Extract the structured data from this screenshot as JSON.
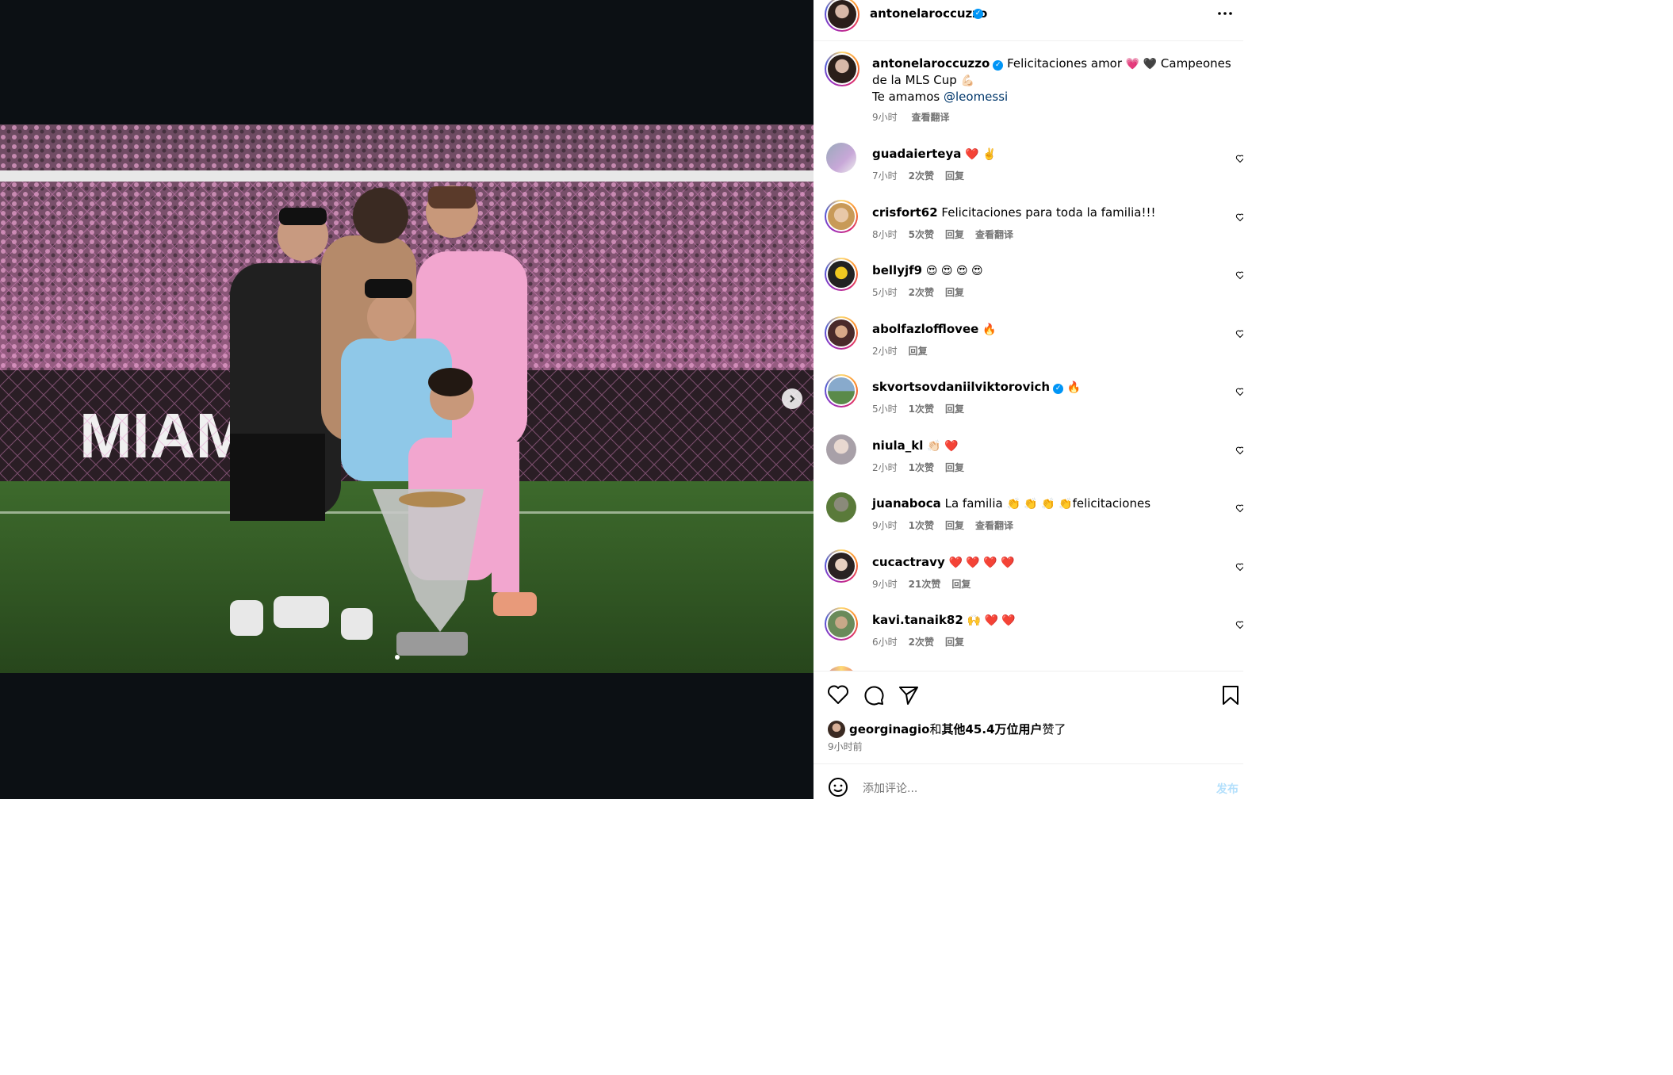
{
  "post": {
    "author": "antonelaroccuzzo",
    "caption_text_1": "Felicitaciones amor",
    "caption_emoji_1": "💗 🖤",
    "caption_text_2": "Campeones de la MLS Cup",
    "caption_emoji_2": "💪🏻",
    "caption_line2": "Te amamos",
    "caption_mention": "@leomessi",
    "time": "9小时",
    "translate": "查看翻译"
  },
  "comments": [
    {
      "user": "guadaierteya",
      "text": "",
      "emoji": "❤️ ✌️",
      "time": "7小时",
      "likes": "2次赞",
      "reply": "回复",
      "translate": ""
    },
    {
      "user": "crisfort62",
      "text": "Felicitaciones para toda la familia!!!",
      "emoji": "",
      "time": "8小时",
      "likes": "5次赞",
      "reply": "回复",
      "translate": "查看翻译"
    },
    {
      "user": "bellyjf9",
      "text": "",
      "emoji": "😍 😍 😍 😍",
      "time": "5小时",
      "likes": "2次赞",
      "reply": "回复",
      "translate": ""
    },
    {
      "user": "abolfazlofflovee",
      "text": "",
      "emoji": "🔥",
      "time": "2小时",
      "likes": "",
      "reply": "回复",
      "translate": ""
    },
    {
      "user": "skvortsovdaniilviktorovich",
      "text": "",
      "emoji": "🔥",
      "time": "5小时",
      "likes": "1次赞",
      "reply": "回复",
      "translate": "",
      "verified": true
    },
    {
      "user": "niula_kl",
      "text": "",
      "emoji": "👏🏻 ❤️",
      "time": "2小时",
      "likes": "1次赞",
      "reply": "回复",
      "translate": ""
    },
    {
      "user": "juanaboca",
      "text": "La familia",
      "emoji": "👏 👏 👏 👏",
      "text2": "felicitaciones",
      "time": "9小时",
      "likes": "1次赞",
      "reply": "回复",
      "translate": "查看翻译"
    },
    {
      "user": "cucactravy",
      "text": "",
      "emoji": "❤️ ❤️ ❤️ ❤️",
      "time": "9小时",
      "likes": "21次赞",
      "reply": "回复",
      "translate": ""
    },
    {
      "user": "kavi.tanaik82",
      "text": "",
      "emoji": "🙌 ❤️ ❤️",
      "time": "6小时",
      "likes": "2次赞",
      "reply": "回复",
      "translate": ""
    }
  ],
  "likes": {
    "user": "georginagio",
    "conj": "和",
    "others": "其他45.4万位用户",
    "suffix": "赞了",
    "time": "9小时前"
  },
  "composer": {
    "placeholder": "添加评论...",
    "post_label": "发布"
  },
  "colors": {
    "accent": "#0095f6",
    "like_red": "#ff3040",
    "media_bg": "#0c1014"
  },
  "icons": [
    "more-options-icon",
    "next-arrow-icon",
    "heart-icon",
    "comment-icon",
    "share-icon",
    "bookmark-icon",
    "emoji-icon"
  ]
}
